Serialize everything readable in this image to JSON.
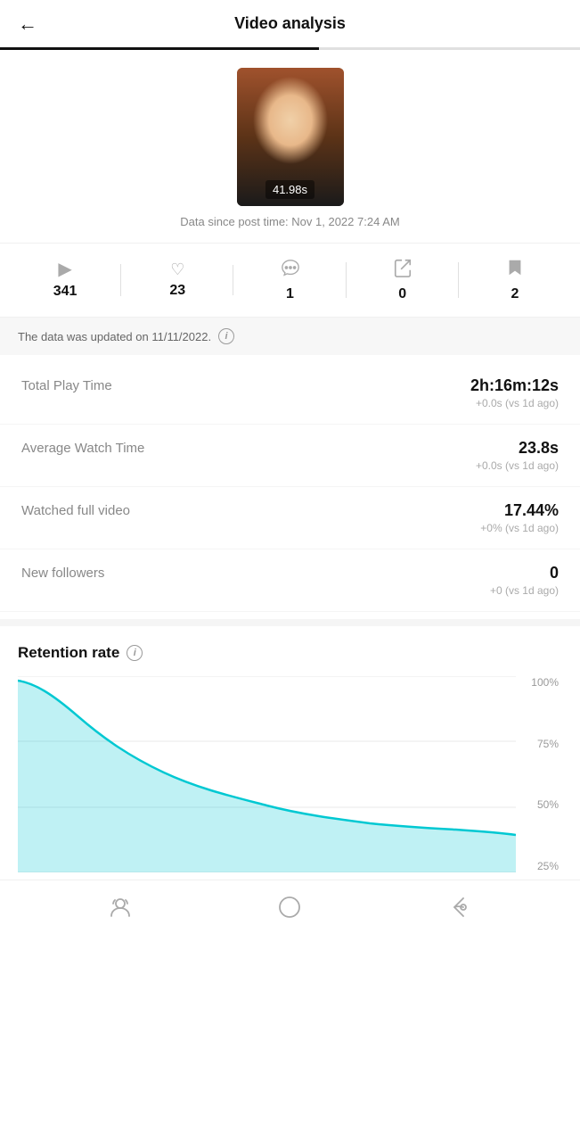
{
  "header": {
    "back_label": "←",
    "title": "Video analysis"
  },
  "progress": {
    "fill_percent": 55
  },
  "video": {
    "duration": "41.98s",
    "meta": "Data since post time: Nov 1, 2022 7:24 AM"
  },
  "stats": [
    {
      "icon": "▶",
      "value": "341",
      "label": "plays"
    },
    {
      "icon": "♡",
      "value": "23",
      "label": "likes"
    },
    {
      "icon": "💬",
      "value": "1",
      "label": "comments"
    },
    {
      "icon": "➤",
      "value": "0",
      "label": "shares"
    },
    {
      "icon": "🔖",
      "value": "2",
      "label": "saves"
    }
  ],
  "update_notice": {
    "text": "The data was updated on 11/11/2022.",
    "icon_label": "i"
  },
  "metrics": [
    {
      "label": "Total Play Time",
      "main_value": "2h:16m:12s",
      "sub_value": "+0.0s (vs 1d ago)"
    },
    {
      "label": "Average Watch Time",
      "main_value": "23.8s",
      "sub_value": "+0.0s (vs 1d ago)"
    },
    {
      "label": "Watched full video",
      "main_value": "17.44%",
      "sub_value": "+0% (vs 1d ago)"
    },
    {
      "label": "New followers",
      "main_value": "0",
      "sub_value": "+0 (vs 1d ago)"
    }
  ],
  "retention": {
    "title": "Retention rate",
    "labels": [
      "100%",
      "75%",
      "50%",
      "25%"
    ],
    "info_icon": "i"
  },
  "bottom_nav": {
    "icons": [
      "profile",
      "home",
      "back"
    ]
  }
}
